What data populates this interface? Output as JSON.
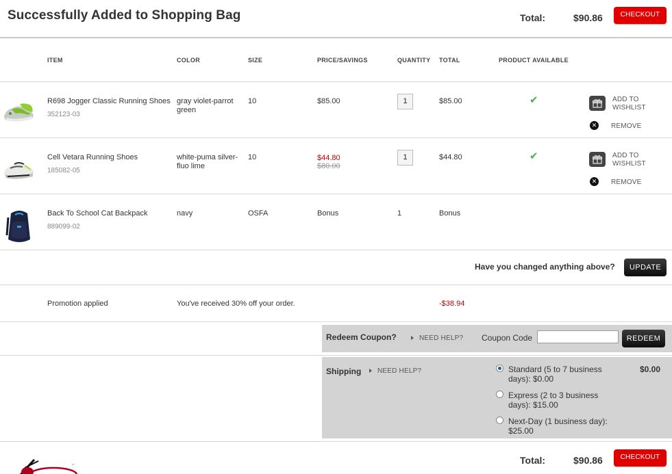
{
  "header": {
    "title": "Successfully Added to Shopping Bag",
    "total_label": "Total:",
    "total_value": "$90.86",
    "checkout_label": "CHECKOUT"
  },
  "columns": [
    "ITEM",
    "COLOR",
    "SIZE",
    "PRICE/SAVINGS",
    "QUANTITY",
    "TOTAL",
    "PRODUCT AVAILABLE"
  ],
  "items": [
    {
      "name": "R698 Jogger Classic Running Shoes",
      "sku": "352123-03",
      "color": "gray violet-parrot green",
      "size": "10",
      "price": "$85.00",
      "quantity": "1",
      "total": "$85.00",
      "image_icon": "green-gray-running-shoe-image"
    },
    {
      "name": "Cell Vetara Running Shoes",
      "sku": "185082-05",
      "color": "white-puma silver-fluo lime",
      "size": "10",
      "sale_price": "$44.80",
      "original_price": "$80.00",
      "quantity": "1",
      "total": "$44.80",
      "image_icon": "white-silver-running-shoe-image"
    },
    {
      "name": "Back To School Cat Backpack",
      "sku": "889099-02",
      "color": "navy",
      "size": "OSFA",
      "price": "Bonus",
      "quantity": "1",
      "total": "Bonus",
      "image_icon": "navy-backpack-image"
    }
  ],
  "item_actions": {
    "wishlist_label": "ADD TO WISHLIST",
    "remove_label": "REMOVE"
  },
  "update": {
    "question": "Have you changed anything above?",
    "button_label": "UPDATE"
  },
  "promotion": {
    "label": "Promotion applied",
    "message": "You've received 30% off your order.",
    "amount": "-$38.94"
  },
  "coupon": {
    "title": "Redeem Coupon?",
    "need_help": "NEED HELP?",
    "code_label": "Coupon Code",
    "code_value": "",
    "button_label": "REDEEM"
  },
  "shipping": {
    "title": "Shipping",
    "need_help": "NEED HELP?",
    "cost": "$0.00",
    "options": [
      {
        "line1": "Standard (5 to 7 business",
        "line2": "days): $0.00",
        "selected": true
      },
      {
        "line1": "Express (2 to 3 business",
        "line2": "days): $15.00",
        "selected": false
      },
      {
        "line1": "Next-Day (1 business day):",
        "line2": "$25.00",
        "selected": false
      }
    ]
  },
  "footer": {
    "total_label": "Total:",
    "total_value": "$90.86",
    "checkout_label": "CHECKOUT"
  },
  "colors": {
    "accent_red": "#e00000",
    "panel_grey": "#d3d3d3",
    "check_green": "#4caf50",
    "sale_red": "#c00000"
  }
}
